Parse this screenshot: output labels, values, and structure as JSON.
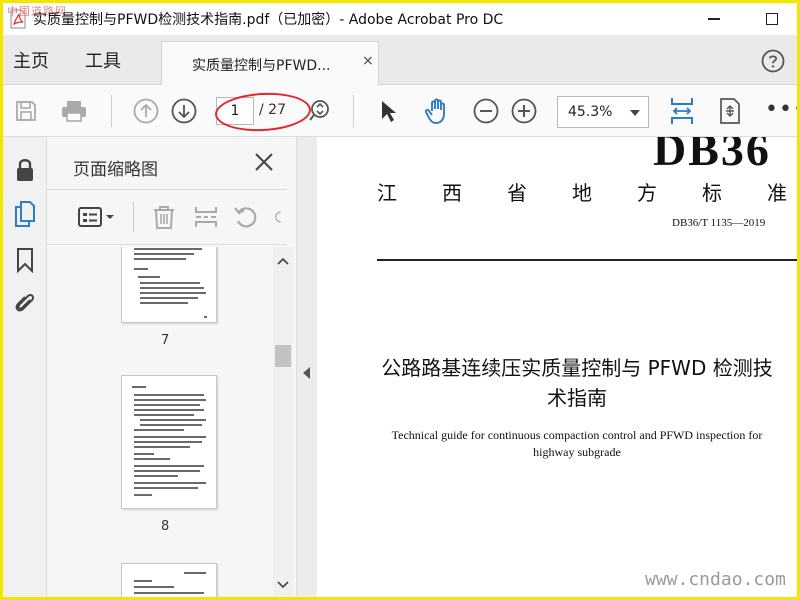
{
  "window": {
    "title": "实质量控制与PFWD检测技术指南.pdf（已加密）- Adobe Acrobat Pro DC",
    "watermark_top": "中国道路网"
  },
  "tabs": {
    "home": "主页",
    "tools": "工具",
    "document": "实质量控制与PFWD...",
    "close": "×"
  },
  "toolbar": {
    "page_current": "1",
    "page_total": "/ 27",
    "zoom": "45.3%",
    "more": "•••"
  },
  "panel": {
    "title": "页面缩略图",
    "thumbnails": [
      {
        "page": "7"
      },
      {
        "page": "8"
      },
      {
        "page": ""
      }
    ]
  },
  "document": {
    "header_code": "DB36",
    "std_chars": [
      "江",
      "西",
      "省",
      "地",
      "方",
      "标",
      "准"
    ],
    "std_number": "DB36/T 1135—2019",
    "title_cn_line1": "公路路基连续压实质量控制与 PFWD 检测技",
    "title_cn_line2": "术指南",
    "title_en_line1": "Technical guide for continuous compaction control and PFWD inspection for",
    "title_en_line2": "highway subgrade",
    "watermark": "www.cndao.com"
  },
  "colors": {
    "frame": "#f2e600",
    "accent_blue": "#2a7ccc",
    "annotation_red": "#e3262e"
  },
  "icons": [
    "save-icon",
    "print-icon",
    "page-up-icon",
    "page-down-icon",
    "page-search-icon",
    "select-arrow-icon",
    "hand-icon",
    "zoom-out-icon",
    "zoom-in-icon",
    "fit-page-icon",
    "rotate-view-icon",
    "lock-icon",
    "pages-icon",
    "bookmark-icon",
    "attachment-icon",
    "help-icon"
  ]
}
